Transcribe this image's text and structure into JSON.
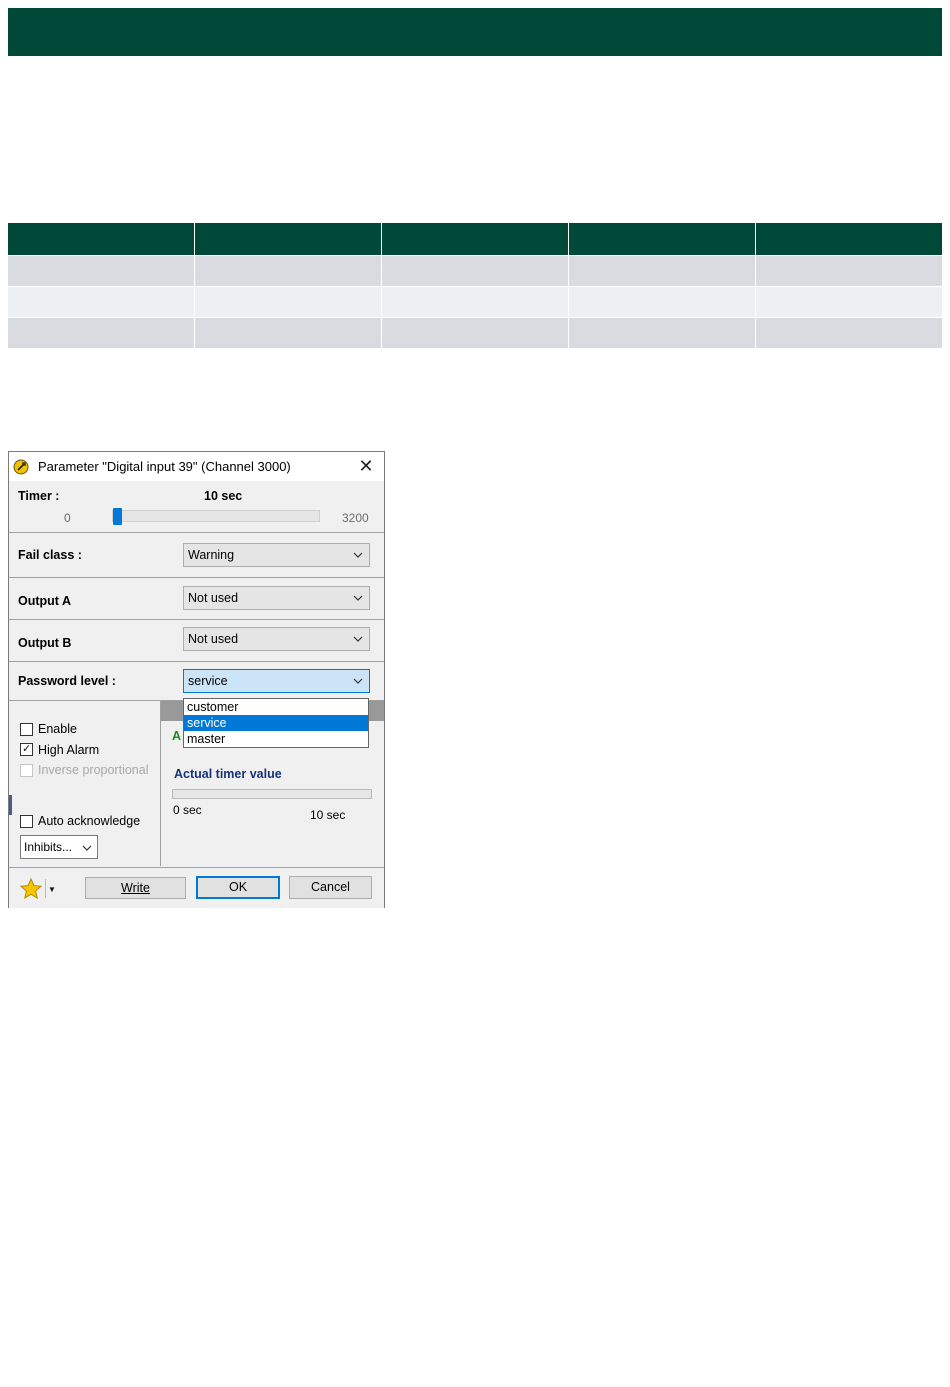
{
  "dialog": {
    "title": "Parameter \"Digital input 39\" (Channel 3000)",
    "timer_label": "Timer :",
    "timer_value": "10 sec",
    "slider_min": "0",
    "slider_max": "3200",
    "slider_position_fraction": 0.003,
    "fail_class_label": "Fail class :",
    "fail_class_value": "Warning",
    "output_a_label": "Output A",
    "output_a_value": "Not used",
    "output_b_label": "Output B",
    "output_b_value": "Not used",
    "password_label": "Password level :",
    "password_value": "service",
    "password_options": [
      "customer",
      "service",
      "master"
    ],
    "enable_label": "Enable",
    "high_alarm_label": "High Alarm",
    "inverse_label": "Inverse proportional",
    "auto_ack_label": "Auto acknowledge",
    "inhibits_label": "Inhibits...",
    "right_a_label": "A",
    "actual_timer_label": "Actual timer value",
    "progress_min": "0 sec",
    "progress_max": "10 sec",
    "progress_fraction": 0.0,
    "write_label": "Write",
    "ok_label": "OK",
    "cancel_label": "Cancel",
    "enable_checked": false,
    "high_alarm_checked": true,
    "inverse_checked": false,
    "auto_ack_checked": false
  },
  "colors": {
    "brand_green": "#004838",
    "accent_blue": "#0078d7"
  }
}
